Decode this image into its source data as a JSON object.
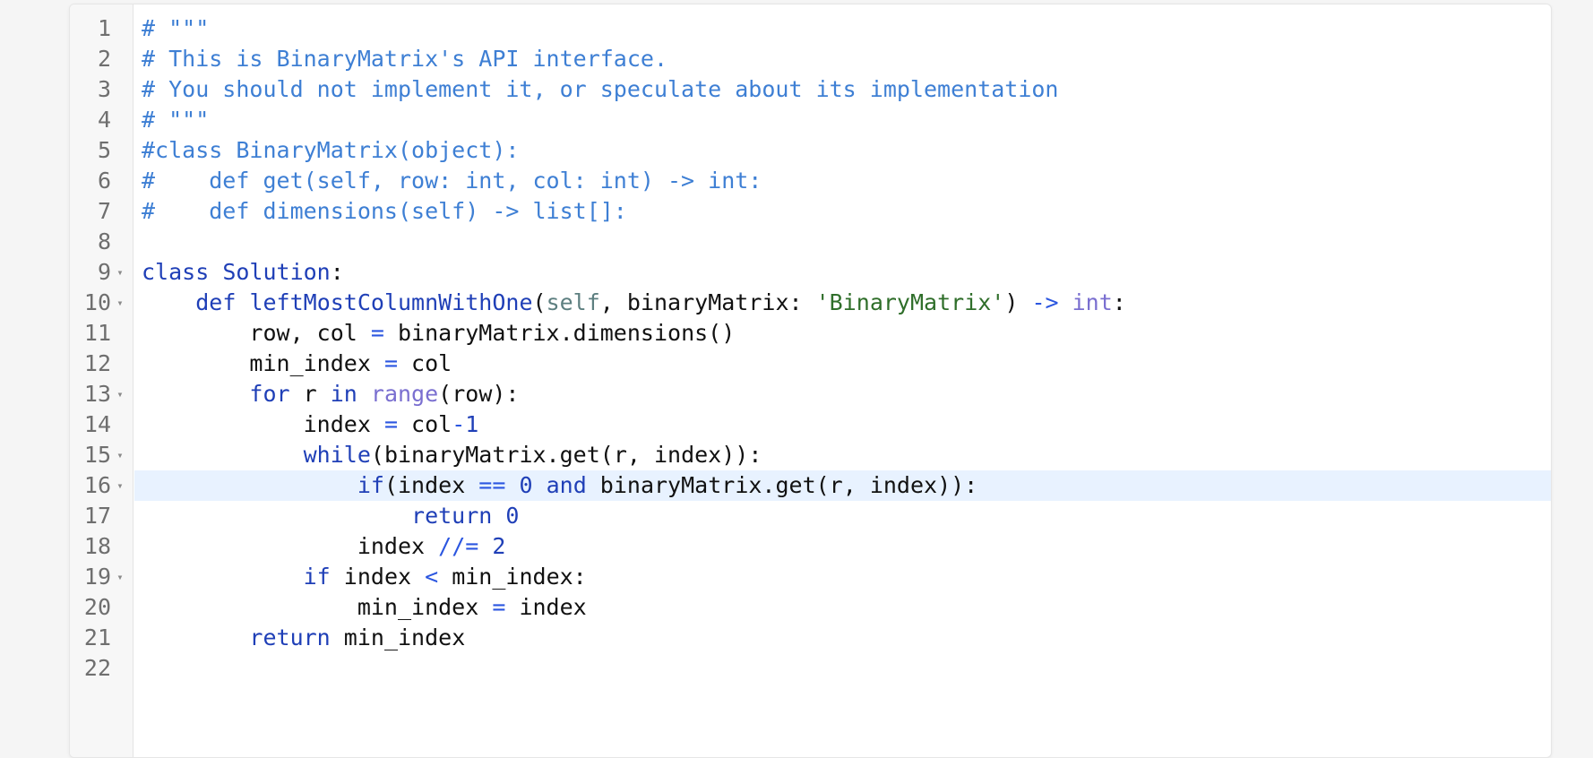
{
  "editor": {
    "language": "python",
    "active_line": 16,
    "colors": {
      "comment": "#3e7fd4",
      "keyword": "#1f3fb7",
      "string": "#2f6e2a",
      "builtin": "#7a6fd0",
      "active_line_bg": "#e8f2ff",
      "gutter_bg": "#f7f7f7"
    },
    "lines": [
      {
        "num": "1",
        "fold": "",
        "tokens": [
          {
            "t": "comment",
            "s": "# \"\"\""
          }
        ]
      },
      {
        "num": "2",
        "fold": "",
        "tokens": [
          {
            "t": "comment",
            "s": "# This is BinaryMatrix's API interface."
          }
        ]
      },
      {
        "num": "3",
        "fold": "",
        "tokens": [
          {
            "t": "comment",
            "s": "# You should not implement it, or speculate about its implementation"
          }
        ]
      },
      {
        "num": "4",
        "fold": "",
        "tokens": [
          {
            "t": "comment",
            "s": "# \"\"\""
          }
        ]
      },
      {
        "num": "5",
        "fold": "",
        "tokens": [
          {
            "t": "comment",
            "s": "#class BinaryMatrix(object):"
          }
        ]
      },
      {
        "num": "6",
        "fold": "",
        "tokens": [
          {
            "t": "comment",
            "s": "#    def get(self, row: int, col: int) -> int:"
          }
        ]
      },
      {
        "num": "7",
        "fold": "",
        "tokens": [
          {
            "t": "comment",
            "s": "#    def dimensions(self) -> list[]:"
          }
        ]
      },
      {
        "num": "8",
        "fold": "",
        "tokens": []
      },
      {
        "num": "9",
        "fold": "▾",
        "tokens": [
          {
            "t": "keyword",
            "s": "class "
          },
          {
            "t": "def",
            "s": "Solution"
          },
          {
            "t": "plain",
            "s": ":"
          }
        ]
      },
      {
        "num": "10",
        "fold": "▾",
        "tokens": [
          {
            "t": "plain",
            "s": "    "
          },
          {
            "t": "keyword",
            "s": "def "
          },
          {
            "t": "def",
            "s": "leftMostColumnWithOne"
          },
          {
            "t": "plain",
            "s": "("
          },
          {
            "t": "self",
            "s": "self"
          },
          {
            "t": "plain",
            "s": ", binaryMatrix: "
          },
          {
            "t": "string",
            "s": "'BinaryMatrix'"
          },
          {
            "t": "plain",
            "s": ") "
          },
          {
            "t": "op",
            "s": "->"
          },
          {
            "t": "plain",
            "s": " "
          },
          {
            "t": "builtin",
            "s": "int"
          },
          {
            "t": "plain",
            "s": ":"
          }
        ]
      },
      {
        "num": "11",
        "fold": "",
        "tokens": [
          {
            "t": "plain",
            "s": "        row, col "
          },
          {
            "t": "op",
            "s": "="
          },
          {
            "t": "plain",
            "s": " binaryMatrix.dimensions()"
          }
        ]
      },
      {
        "num": "12",
        "fold": "",
        "tokens": [
          {
            "t": "plain",
            "s": "        min_index "
          },
          {
            "t": "op",
            "s": "="
          },
          {
            "t": "plain",
            "s": " col"
          }
        ]
      },
      {
        "num": "13",
        "fold": "▾",
        "tokens": [
          {
            "t": "plain",
            "s": "        "
          },
          {
            "t": "keyword",
            "s": "for"
          },
          {
            "t": "plain",
            "s": " r "
          },
          {
            "t": "keyword",
            "s": "in"
          },
          {
            "t": "plain",
            "s": " "
          },
          {
            "t": "builtin",
            "s": "range"
          },
          {
            "t": "plain",
            "s": "(row):"
          }
        ]
      },
      {
        "num": "14",
        "fold": "",
        "tokens": [
          {
            "t": "plain",
            "s": "            index "
          },
          {
            "t": "op",
            "s": "="
          },
          {
            "t": "plain",
            "s": " col"
          },
          {
            "t": "op",
            "s": "-"
          },
          {
            "t": "num",
            "s": "1"
          }
        ]
      },
      {
        "num": "15",
        "fold": "▾",
        "tokens": [
          {
            "t": "plain",
            "s": "            "
          },
          {
            "t": "keyword",
            "s": "while"
          },
          {
            "t": "plain",
            "s": "(binaryMatrix.get(r, index)):"
          }
        ]
      },
      {
        "num": "16",
        "fold": "▾",
        "tokens": [
          {
            "t": "plain",
            "s": "                "
          },
          {
            "t": "keyword",
            "s": "if"
          },
          {
            "t": "plain",
            "s": "(index "
          },
          {
            "t": "op",
            "s": "=="
          },
          {
            "t": "plain",
            "s": " "
          },
          {
            "t": "num",
            "s": "0"
          },
          {
            "t": "plain",
            "s": " "
          },
          {
            "t": "keyword",
            "s": "and"
          },
          {
            "t": "plain",
            "s": " binaryMatrix.get(r, index)):"
          }
        ]
      },
      {
        "num": "17",
        "fold": "",
        "tokens": [
          {
            "t": "plain",
            "s": "                    "
          },
          {
            "t": "keyword",
            "s": "return"
          },
          {
            "t": "plain",
            "s": " "
          },
          {
            "t": "num",
            "s": "0"
          }
        ]
      },
      {
        "num": "18",
        "fold": "",
        "tokens": [
          {
            "t": "plain",
            "s": "                index "
          },
          {
            "t": "op",
            "s": "//="
          },
          {
            "t": "plain",
            "s": " "
          },
          {
            "t": "num",
            "s": "2"
          }
        ]
      },
      {
        "num": "19",
        "fold": "▾",
        "tokens": [
          {
            "t": "plain",
            "s": "            "
          },
          {
            "t": "keyword",
            "s": "if"
          },
          {
            "t": "plain",
            "s": " index "
          },
          {
            "t": "op",
            "s": "<"
          },
          {
            "t": "plain",
            "s": " min_index:"
          }
        ]
      },
      {
        "num": "20",
        "fold": "",
        "tokens": [
          {
            "t": "plain",
            "s": "                min_index "
          },
          {
            "t": "op",
            "s": "="
          },
          {
            "t": "plain",
            "s": " index"
          }
        ]
      },
      {
        "num": "21",
        "fold": "",
        "tokens": [
          {
            "t": "plain",
            "s": "        "
          },
          {
            "t": "keyword",
            "s": "return"
          },
          {
            "t": "plain",
            "s": " min_index"
          }
        ]
      },
      {
        "num": "22",
        "fold": "",
        "tokens": []
      }
    ]
  }
}
